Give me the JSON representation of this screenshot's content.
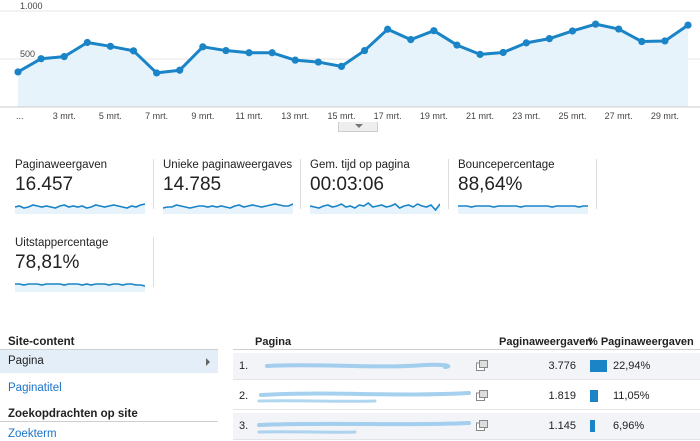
{
  "chart_data": {
    "type": "area",
    "y_ticks": [
      "1.000",
      "500"
    ],
    "ylim": [
      0,
      1000
    ],
    "x_ticks": [
      "...",
      "3 mrt.",
      "5 mrt.",
      "7 mrt.",
      "9 mrt.",
      "11 mrt.",
      "13 mrt.",
      "15 mrt.",
      "17 mrt.",
      "19 mrt.",
      "21 mrt.",
      "23 mrt.",
      "25 mrt.",
      "27 mrt.",
      "29 mrt."
    ],
    "values": [
      365,
      503,
      525,
      672,
      632,
      585,
      355,
      383,
      627,
      588,
      565,
      565,
      488,
      468,
      423,
      588,
      810,
      702,
      795,
      645,
      548,
      568,
      668,
      712,
      792,
      863,
      812,
      682,
      688,
      853
    ],
    "line_color": "#1a84c7",
    "fill_color": "#e6f3fb"
  },
  "metrics": [
    {
      "label": "Paginaweergaven",
      "value": "16.457",
      "spark": [
        5,
        6,
        4,
        5,
        7,
        6,
        5,
        6,
        5,
        4,
        6,
        7,
        5,
        6,
        5,
        6,
        4,
        5,
        7,
        6,
        5,
        6,
        7,
        6,
        5,
        4,
        6,
        5,
        7,
        8
      ]
    },
    {
      "label": "Unieke paginaweergaves",
      "value": "14.785",
      "spark": [
        4,
        5,
        5,
        7,
        6,
        5,
        4,
        5,
        6,
        6,
        5,
        6,
        5,
        6,
        5,
        4,
        6,
        7,
        5,
        6,
        7,
        6,
        5,
        6,
        7,
        8,
        7,
        6,
        6,
        8
      ]
    },
    {
      "label": "Gem. tijd op pagina",
      "value": "00:03:06",
      "spark": [
        6,
        5,
        4,
        6,
        7,
        5,
        6,
        8,
        5,
        6,
        4,
        7,
        6,
        9,
        5,
        6,
        7,
        5,
        6,
        8,
        4,
        6,
        7,
        5,
        8,
        6,
        5,
        7,
        2,
        8
      ]
    },
    {
      "label": "Bouncepercentage",
      "value": "88,64%",
      "spark": [
        6,
        6,
        6,
        5,
        6,
        6,
        6,
        6,
        5,
        6,
        6,
        6,
        6,
        6,
        5,
        6,
        6,
        6,
        6,
        6,
        6,
        5,
        6,
        6,
        6,
        6,
        6,
        5,
        6,
        6
      ]
    },
    {
      "label": "Uitstappercentage",
      "value": "78,81%",
      "spark": [
        6,
        6,
        5,
        6,
        6,
        6,
        5,
        6,
        6,
        6,
        6,
        5,
        6,
        6,
        6,
        5,
        6,
        5,
        6,
        6,
        6,
        5,
        6,
        6,
        5,
        6,
        6,
        5,
        5,
        4
      ]
    }
  ],
  "nav": {
    "heading1": "Site-content",
    "item_pagina": "Pagina",
    "item_paginatitel": "Paginatitel",
    "heading2": "Zoekopdrachten op site",
    "item_zoekterm": "Zoekterm"
  },
  "table": {
    "col_page": "Pagina",
    "col_views": "Paginaweergaven",
    "col_pct": "% Paginaweergaven",
    "rows": [
      {
        "num": "1.",
        "views": "3.776",
        "pct_label": "22,94%",
        "pct": 22.94
      },
      {
        "num": "2.",
        "views": "1.819",
        "pct_label": "11,05%",
        "pct": 11.05
      },
      {
        "num": "3.",
        "views": "1.145",
        "pct_label": "6,96%",
        "pct": 6.96
      }
    ]
  }
}
